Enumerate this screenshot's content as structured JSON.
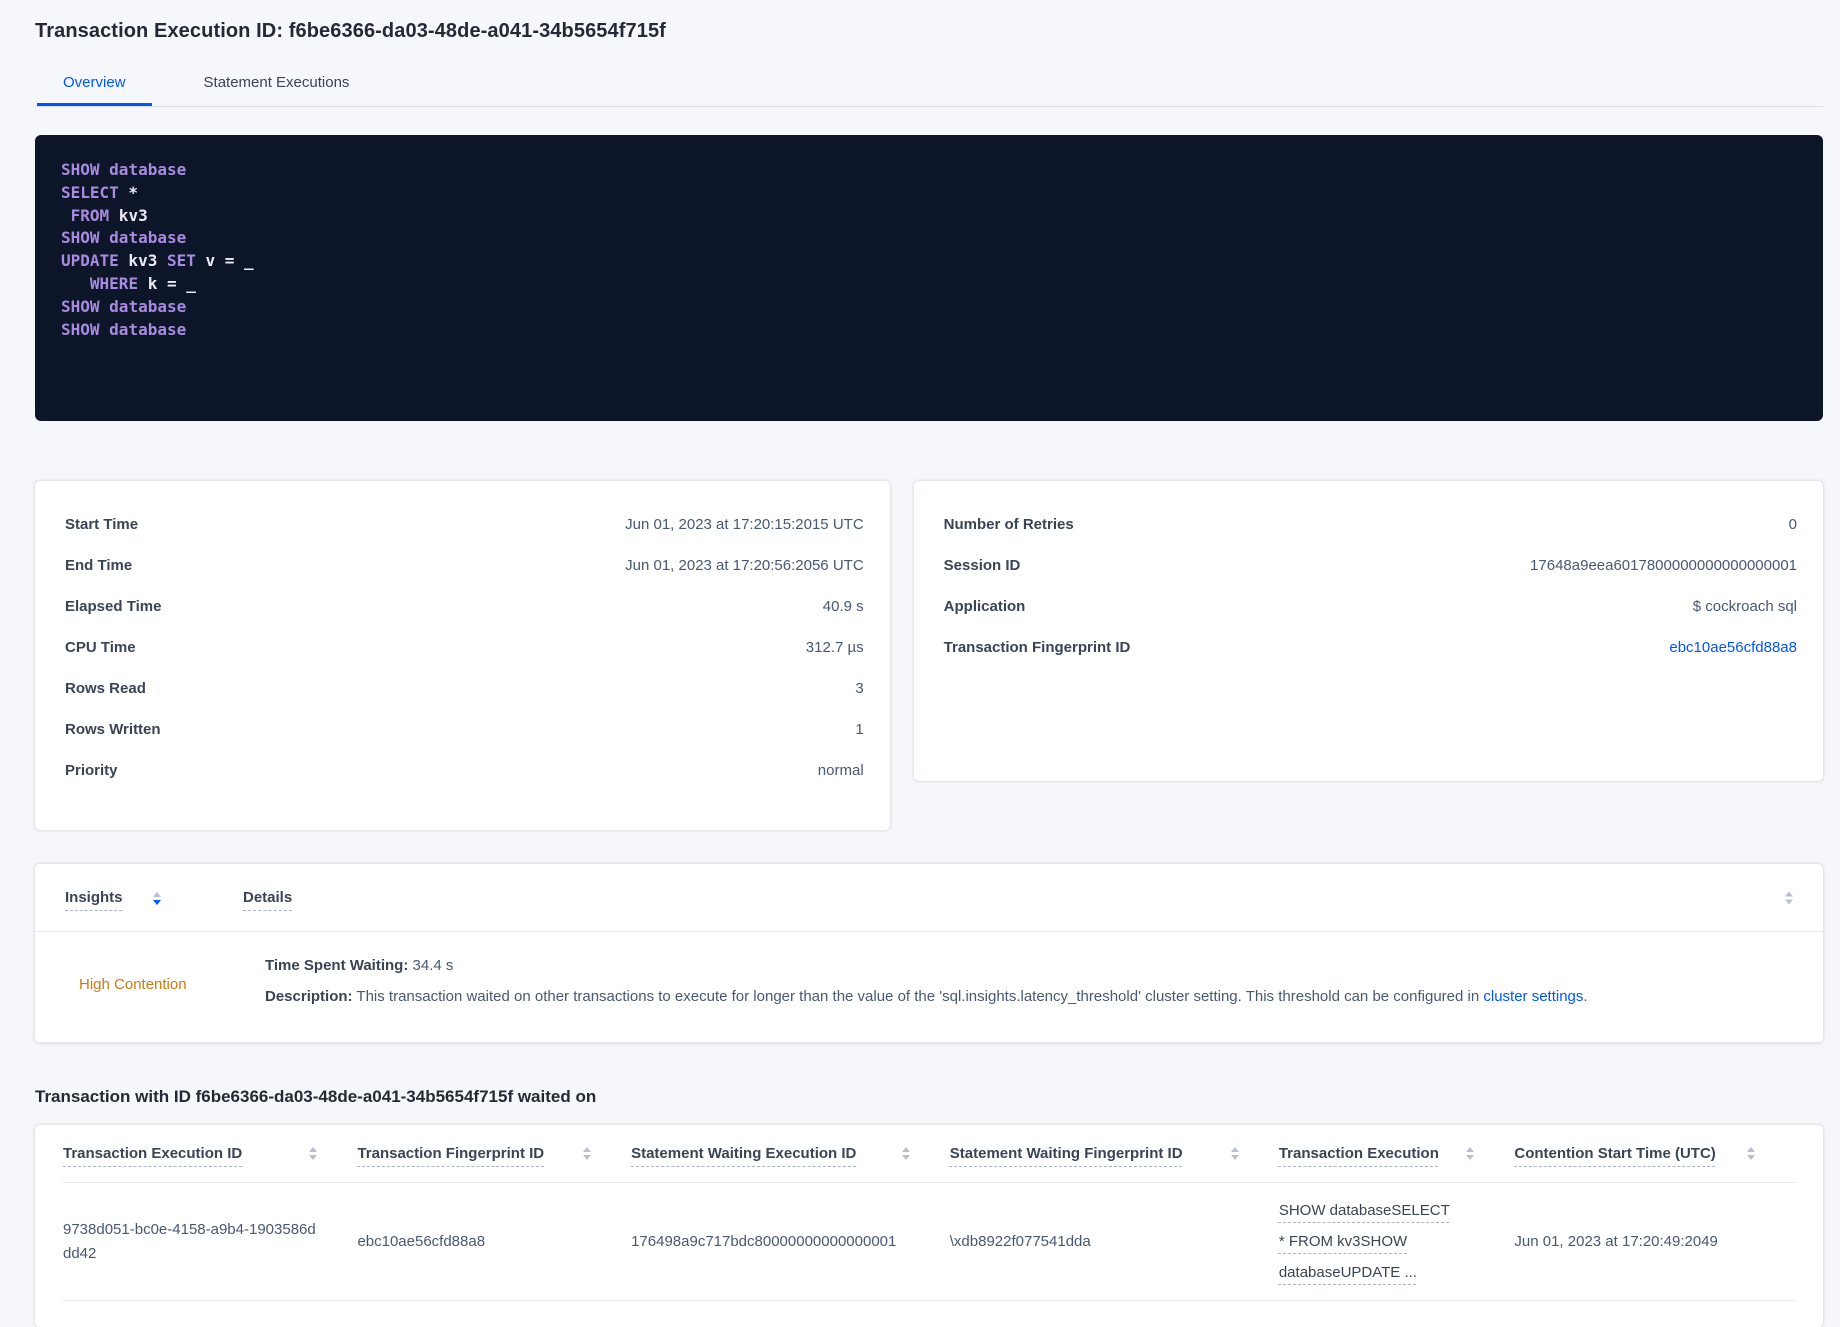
{
  "header": {
    "title": "Transaction Execution ID: f6be6366-da03-48de-a041-34b5654f715f"
  },
  "tabs": [
    {
      "label": "Overview",
      "active": true
    },
    {
      "label": "Statement Executions",
      "active": false
    }
  ],
  "sql_box": {
    "lines": [
      [
        {
          "c": "k",
          "t": "SHOW"
        },
        {
          "c": "i",
          "t": " "
        },
        {
          "c": "k",
          "t": "database"
        }
      ],
      [
        {
          "c": "k",
          "t": "SELECT"
        },
        {
          "c": "i",
          "t": " *"
        }
      ],
      [
        {
          "c": "i",
          "t": " "
        },
        {
          "c": "k",
          "t": "FROM"
        },
        {
          "c": "i",
          "t": " kv3"
        }
      ],
      [
        {
          "c": "k",
          "t": "SHOW"
        },
        {
          "c": "i",
          "t": " "
        },
        {
          "c": "k",
          "t": "database"
        }
      ],
      [
        {
          "c": "k",
          "t": "UPDATE"
        },
        {
          "c": "i",
          "t": " kv3 "
        },
        {
          "c": "k",
          "t": "SET"
        },
        {
          "c": "i",
          "t": " v = _"
        }
      ],
      [
        {
          "c": "i",
          "t": "   "
        },
        {
          "c": "k",
          "t": "WHERE"
        },
        {
          "c": "i",
          "t": " k = _"
        }
      ],
      [
        {
          "c": "k",
          "t": "SHOW"
        },
        {
          "c": "i",
          "t": " "
        },
        {
          "c": "k",
          "t": "database"
        }
      ],
      [
        {
          "c": "k",
          "t": "SHOW"
        },
        {
          "c": "i",
          "t": " "
        },
        {
          "c": "k",
          "t": "database"
        }
      ]
    ]
  },
  "summary_left": {
    "rows": [
      {
        "label": "Start Time",
        "value": "Jun 01, 2023 at 17:20:15:2015 UTC"
      },
      {
        "label": "End Time",
        "value": "Jun 01, 2023 at 17:20:56:2056 UTC"
      },
      {
        "label": "Elapsed Time",
        "value": "40.9 s"
      },
      {
        "label": "CPU Time",
        "value": "312.7 µs"
      },
      {
        "label": "Rows Read",
        "value": "3"
      },
      {
        "label": "Rows Written",
        "value": "1"
      },
      {
        "label": "Priority",
        "value": "normal"
      }
    ]
  },
  "summary_right": {
    "rows": [
      {
        "label": "Number of Retries",
        "value": "0"
      },
      {
        "label": "Session ID",
        "value": "17648a9eea6017800000000000000001"
      },
      {
        "label": "Application",
        "value": "$ cockroach sql"
      },
      {
        "label": "Transaction Fingerprint ID",
        "value": "ebc10ae56cfd88a8",
        "link": true
      }
    ]
  },
  "insights": {
    "columns": [
      "Insights",
      "Details"
    ],
    "row": {
      "insight": "High Contention",
      "waiting_label": "Time Spent Waiting:",
      "waiting_value": "34.4 s",
      "description_label": "Description:",
      "description_text": "This transaction waited on other transactions to execute for longer than the value of the 'sql.insights.latency_threshold' cluster setting. This threshold can be configured in ",
      "description_link": "cluster settings",
      "description_suffix": "."
    }
  },
  "waited_on": {
    "heading": "Transaction with ID f6be6366-da03-48de-a041-34b5654f715f waited on",
    "columns": [
      "Transaction Execution ID",
      "Transaction Fingerprint ID",
      "Statement Waiting Execution ID",
      "Statement Waiting Fingerprint ID",
      "Transaction Execution",
      "Contention Start Time (UTC)"
    ],
    "rows": [
      {
        "cells": [
          "9738d051-bc0e-4158-a9b4-1903586ddd42",
          "ebc10ae56cfd88a8",
          "176498a9c717bdc80000000000000001",
          "\\xdb8922f077541dda",
          "SHOW databaseSELECT * FROM kv3SHOW databaseUPDATE ...",
          "Jun 01, 2023 at 17:20:49:2049"
        ]
      }
    ]
  },
  "colors": {
    "accent_blue": "#0055ff",
    "warning_orange": "#d0790f",
    "code_bg": "#0c1628",
    "code_keyword": "#a98ae0",
    "code_plain": "#edeaf7",
    "title_dark": "#242a35",
    "label_dark": "#394455",
    "text_body": "#475872"
  }
}
